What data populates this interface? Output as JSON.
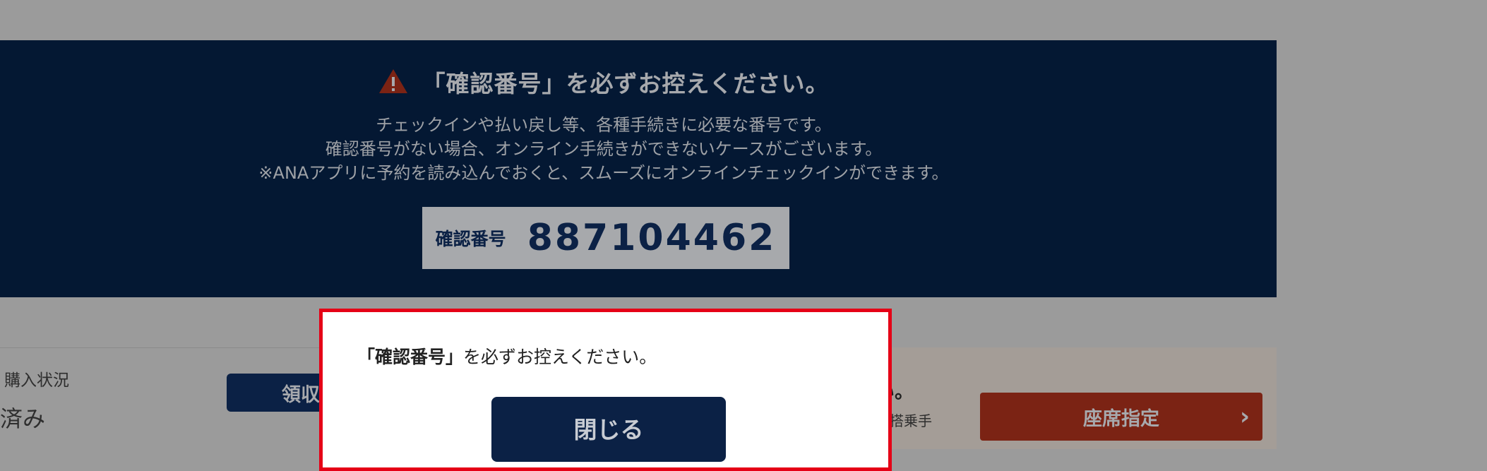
{
  "banner": {
    "title": "「確認番号」を必ずお控えください。",
    "icon": "warning-icon",
    "description": [
      "チェックインや払い戻し等、各種手続きに必要な番号です。",
      "確認番号がない場合、オンライン手続きができないケースがございます。",
      "※ANAアプリに予約を読み込んでおくと、スムーズにオンラインチェックインができます。"
    ],
    "code_label": "確認番号",
    "code_value": "887104462"
  },
  "lower": {
    "purchase_label": "購入状況",
    "purchase_value": "済み",
    "receipt_button": "領収",
    "notice_head": "い。",
    "notice_sub": "に搭乗手",
    "seat_button": "座席指定",
    "seat_icon": "chevron-right-icon"
  },
  "modal": {
    "bold_text": "「確認番号」",
    "text": "を必ずお控えください。",
    "close_button": "閉じる"
  },
  "colors": {
    "banner_bg": "#041833",
    "modal_border": "#e50016",
    "button_navy": "#0b2145",
    "seat_button": "#7b2314"
  }
}
